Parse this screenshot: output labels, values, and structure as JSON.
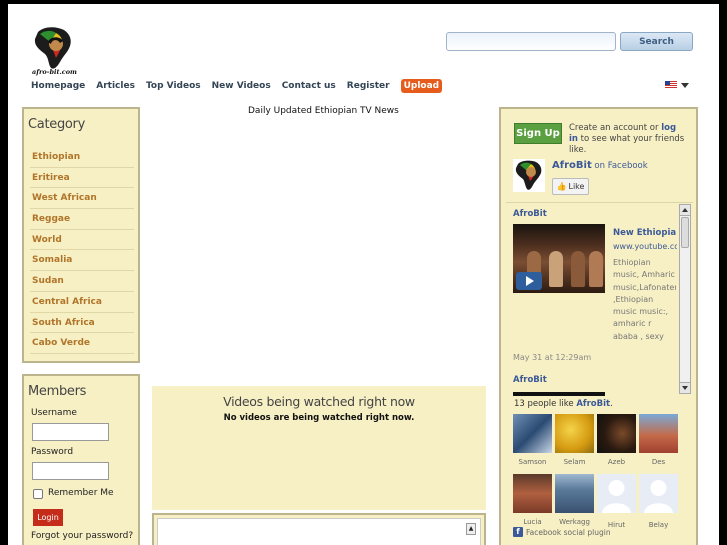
{
  "header": {
    "logo_alt": "afro-bit.com",
    "search": {
      "placeholder": "",
      "value": "",
      "button_label": "Search"
    }
  },
  "nav": {
    "items": [
      "Homepage",
      "Articles",
      "Top Videos",
      "New Videos",
      "Contact us",
      "Register"
    ],
    "upload_label": "Upload",
    "language_flag": "us-flag-icon"
  },
  "category": {
    "title": "Category",
    "items": [
      "Ethiopian",
      "Eritirea",
      "West African",
      "Reggae",
      "World",
      "Somalia",
      "Sudan",
      "Central Africa",
      "South Africa",
      "Cabo Verde"
    ]
  },
  "members": {
    "title": "Members",
    "username_label": "Username",
    "password_label": "Password",
    "remember_label": "Remember Me",
    "login_label": "Login",
    "forgot_label": "Forgot your password?"
  },
  "main": {
    "title": "Daily Updated Ethiopian TV News",
    "watching_title": "Videos being watched right now",
    "watching_empty": "No videos are being watched right now."
  },
  "facebook": {
    "signup_label": "Sign Up",
    "signup_text_pre": "Create an account or ",
    "signup_login": "log in",
    "signup_text_post": " to see what your friends like.",
    "page_name": "AfroBit",
    "on_facebook": " on Facebook",
    "like_label": "Like",
    "feed": {
      "author": "AfroBit",
      "video_title": "New Ethiopia m",
      "video_url": "www.youtube.co",
      "video_desc": "Ethiopian music, Amharic music,Lafonaten, ,Ethiopian music music:, amharic r ababa , sexy Eth women,...",
      "time": "May 31 at 12:29am",
      "author2": "AfroBit"
    },
    "likes_count_pre": "13 people like ",
    "likes_page": "AfroBit",
    "likes_count_post": ".",
    "fans": [
      "Samson",
      "Selam",
      "Azeb",
      "Des",
      "Lucia",
      "Werkagg",
      "Hirut",
      "Belay"
    ],
    "plugin_label": "Facebook social plugin"
  },
  "colors": {
    "box_bg": "#f7f0c4",
    "box_border": "#bcb48c",
    "category_link": "#b0752a",
    "facebook_blue": "#3b5998",
    "upload_orange": "#e65c1c",
    "login_red": "#c52c1a",
    "signup_green": "#5aa040"
  }
}
